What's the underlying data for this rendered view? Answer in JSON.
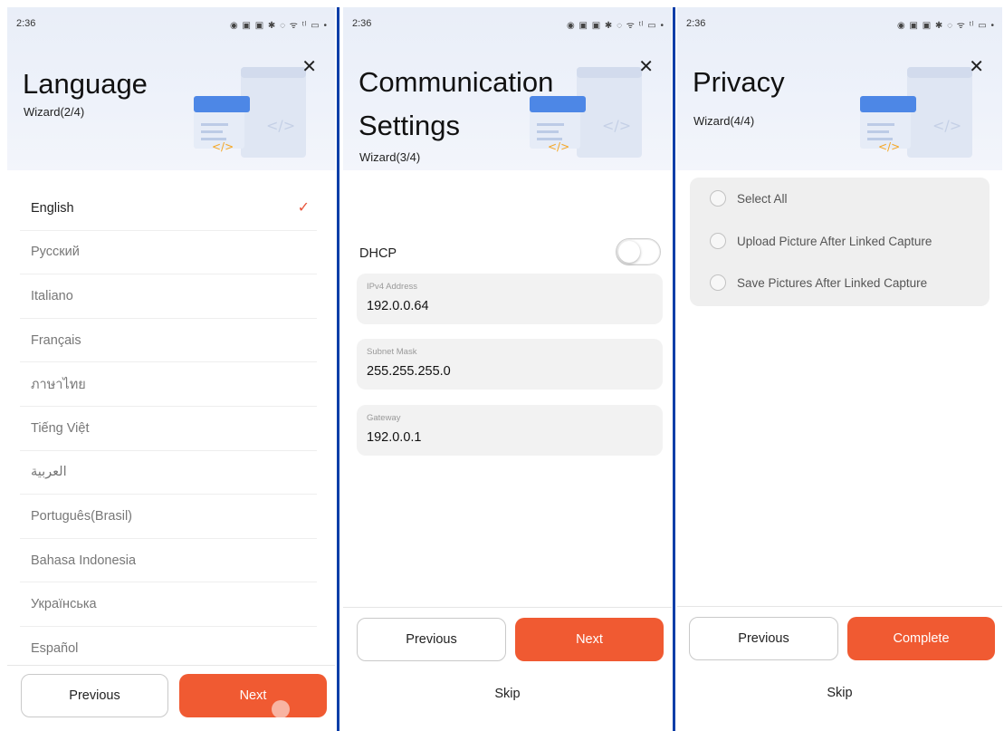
{
  "status_bar": {
    "time": "2:36",
    "icons": "◉ ▣ ▣ ✱ ◌ ᯤ ᵗˡ ▭ •"
  },
  "screen_language": {
    "title": "Language",
    "subtitle": "Wizard(2/4)",
    "close_glyph": "✕",
    "languages": [
      {
        "label": "English",
        "selected": true
      },
      {
        "label": "Русский",
        "selected": false
      },
      {
        "label": "Italiano",
        "selected": false
      },
      {
        "label": "Français",
        "selected": false
      },
      {
        "label": "ภาษาไทย",
        "selected": false
      },
      {
        "label": "Tiếng Việt",
        "selected": false
      },
      {
        "label": "العربية",
        "selected": false
      },
      {
        "label": "Português(Brasil)",
        "selected": false
      },
      {
        "label": "Bahasa Indonesia",
        "selected": false
      },
      {
        "label": "Українська",
        "selected": false
      },
      {
        "label": "Español",
        "selected": false
      }
    ],
    "check_glyph": "✓",
    "previous_label": "Previous",
    "next_label": "Next"
  },
  "screen_communication": {
    "title_line1": "Communication",
    "title_line2": "Settings",
    "subtitle": "Wizard(3/4)",
    "close_glyph": "✕",
    "dhcp_label": "DHCP",
    "dhcp_enabled": false,
    "fields": [
      {
        "label": "IPv4 Address",
        "value": "192.0.0.64"
      },
      {
        "label": "Subnet Mask",
        "value": "255.255.255.0"
      },
      {
        "label": "Gateway",
        "value": "192.0.0.1"
      }
    ],
    "previous_label": "Previous",
    "next_label": "Next",
    "skip_label": "Skip"
  },
  "screen_privacy": {
    "title": "Privacy",
    "subtitle": "Wizard(4/4)",
    "close_glyph": "✕",
    "options": [
      {
        "label": "Select All",
        "checked": false
      },
      {
        "label": "Upload Picture After Linked Capture",
        "checked": false
      },
      {
        "label": "Save Pictures After Linked Capture",
        "checked": false
      }
    ],
    "previous_label": "Previous",
    "complete_label": "Complete",
    "skip_label": "Skip"
  },
  "colors": {
    "accent": "#f05a32",
    "check": "#e8543a",
    "divider": "#0b3ea8"
  }
}
